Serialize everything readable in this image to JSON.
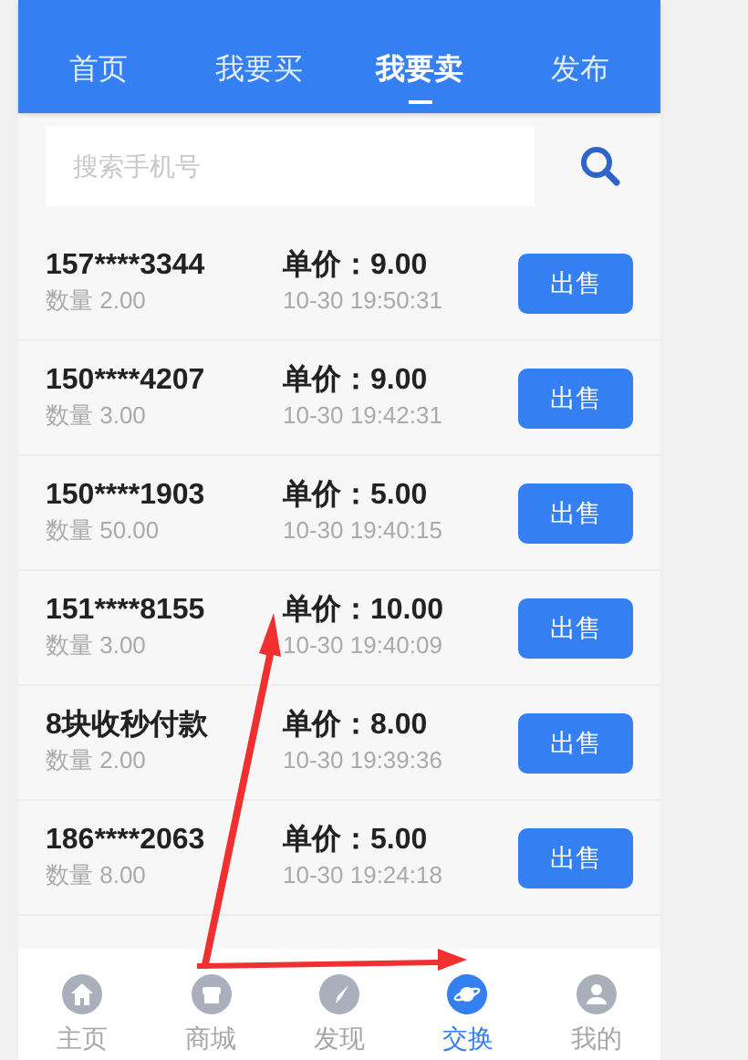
{
  "tabs": [
    {
      "label": "首页",
      "selected": false
    },
    {
      "label": "我要买",
      "selected": false
    },
    {
      "label": "我要卖",
      "selected": true
    },
    {
      "label": "发布",
      "selected": false
    }
  ],
  "search": {
    "placeholder": "搜索手机号"
  },
  "orders": [
    {
      "name": "157****3344",
      "quantity": "数量 2.00",
      "price": "单价：9.00",
      "time": "10-30 19:50:31",
      "action": "出售"
    },
    {
      "name": "150****4207",
      "quantity": "数量 3.00",
      "price": "单价：9.00",
      "time": "10-30 19:42:31",
      "action": "出售"
    },
    {
      "name": "150****1903",
      "quantity": "数量 50.00",
      "price": "单价：5.00",
      "time": "10-30 19:40:15",
      "action": "出售"
    },
    {
      "name": "151****8155",
      "quantity": "数量 3.00",
      "price": "单价：10.00",
      "time": "10-30 19:40:09",
      "action": "出售"
    },
    {
      "name": "8块收秒付款",
      "quantity": "数量 2.00",
      "price": "单价：8.00",
      "time": "10-30 19:39:36",
      "action": "出售"
    },
    {
      "name": "186****2063",
      "quantity": "数量 8.00",
      "price": "单价：5.00",
      "time": "10-30 19:24:18",
      "action": "出售"
    }
  ],
  "bottom_nav": [
    {
      "label": "主页",
      "kind": "home",
      "selected": false
    },
    {
      "label": "商城",
      "kind": "shop",
      "selected": false
    },
    {
      "label": "发现",
      "kind": "compass",
      "selected": false
    },
    {
      "label": "交换",
      "kind": "planet",
      "selected": true
    },
    {
      "label": "我的",
      "kind": "user",
      "selected": false
    }
  ]
}
